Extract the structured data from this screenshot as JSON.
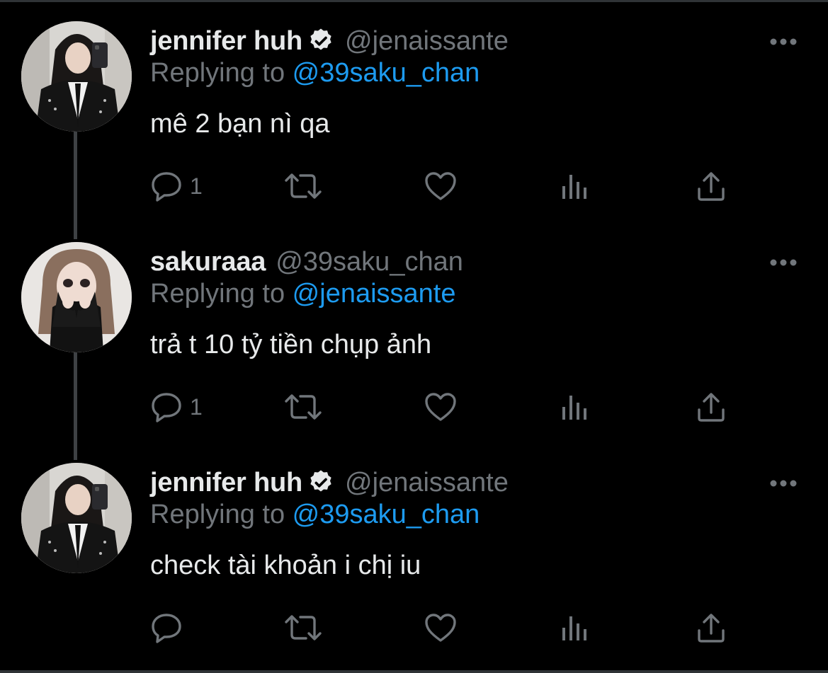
{
  "colors": {
    "background": "#000000",
    "name": "#e7e9ea",
    "secondary": "#71767b",
    "mention": "#1d9bf0",
    "thread_line": "#3e4144"
  },
  "tweets": [
    {
      "display_name": "jennifer huh",
      "verified": true,
      "handle": "@jenaissante",
      "replying_prefix": "Replying to ",
      "replying_to": "@39saku_chan",
      "text": "mê 2 bạn nì qa",
      "reply_count": "1",
      "avatar_icon": "profile-photo-jennifer"
    },
    {
      "display_name": "sakuraaa",
      "verified": false,
      "handle": "@39saku_chan",
      "replying_prefix": "Replying to ",
      "replying_to": "@jenaissante",
      "text": "trả t 10 tỷ tiền chụp ảnh",
      "reply_count": "1",
      "avatar_icon": "profile-photo-sakura"
    },
    {
      "display_name": "jennifer huh",
      "verified": true,
      "handle": "@jenaissante",
      "replying_prefix": "Replying to ",
      "replying_to": "@39saku_chan",
      "text": "check tài khoản i chị iu",
      "reply_count": "",
      "avatar_icon": "profile-photo-jennifer"
    }
  ],
  "action_icons": [
    "reply-icon",
    "retweet-icon",
    "like-icon",
    "views-icon",
    "share-icon"
  ]
}
